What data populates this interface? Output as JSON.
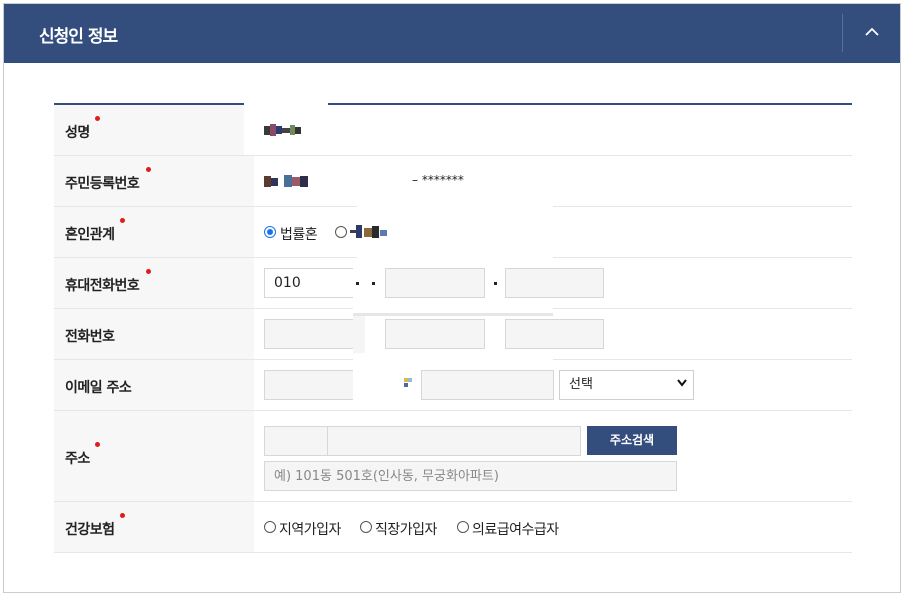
{
  "panel": {
    "title": "신청인 정보",
    "collapse_icon": "chevron-up-icon"
  },
  "fields": {
    "name": {
      "label": "성명",
      "required": true
    },
    "rrn": {
      "label": "주민등록번호",
      "required": true,
      "suffix": "– *******"
    },
    "marital": {
      "label": "혼인관계",
      "required": true,
      "options": [
        "법률혼",
        ""
      ],
      "selected": "법률혼"
    },
    "mobile": {
      "label": "휴대전화번호",
      "required": true,
      "part1": "010",
      "part2": "",
      "part3": ""
    },
    "phone": {
      "label": "전화번호",
      "required": false,
      "part1": "",
      "part2": "",
      "part3": ""
    },
    "email": {
      "label": "이메일 주소",
      "required": false,
      "local": "",
      "domain": "",
      "select_value": "선택"
    },
    "address": {
      "label": "주소",
      "required": true,
      "zip": "",
      "addr1": "",
      "search_button": "주소검색",
      "detail_placeholder": "예) 101동 501호(인사동, 무궁화아파트)"
    },
    "insurance": {
      "label": "건강보험",
      "required": true,
      "options": [
        "지역가입자",
        "직장가입자",
        "의료급여수급자"
      ]
    }
  },
  "colors": {
    "header": "#334d7d",
    "required_dot": "#e01c1c",
    "radio_checked": "#1a73e8"
  }
}
